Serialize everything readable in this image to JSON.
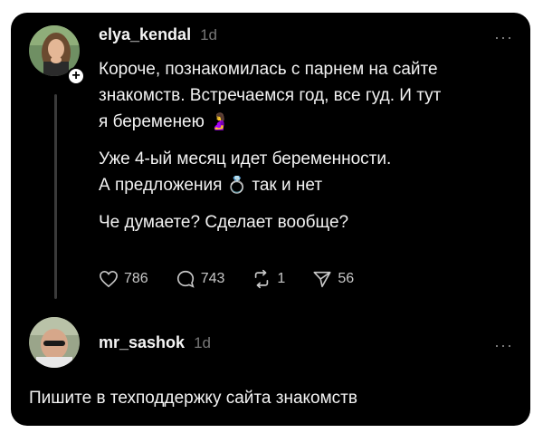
{
  "post": {
    "username": "elya_kendal",
    "time": "1d",
    "paragraphs": [
      [
        "Короче, познакомилась с парнем на сайте",
        "знакомств. Встречаемся год, все гуд. И тут",
        "я беременею"
      ],
      [
        "Уже 4-ый месяц идет беременности.",
        "А предложения",
        "так и нет"
      ],
      [
        "Че думаете? Сделает вообще?"
      ]
    ],
    "emoji_pregnant": "🤰",
    "emoji_ring": "💍",
    "likes": "786",
    "comments": "743",
    "reposts": "1",
    "shares": "56",
    "more": "···"
  },
  "reply": {
    "username": "mr_sashok",
    "time": "1d",
    "text": "Пишите в техподдержку сайта знакомств",
    "more": "···"
  },
  "colors": {
    "background": "#000000",
    "text": "#f2f2f2",
    "muted": "#777777",
    "icon": "#c8c8c8"
  }
}
